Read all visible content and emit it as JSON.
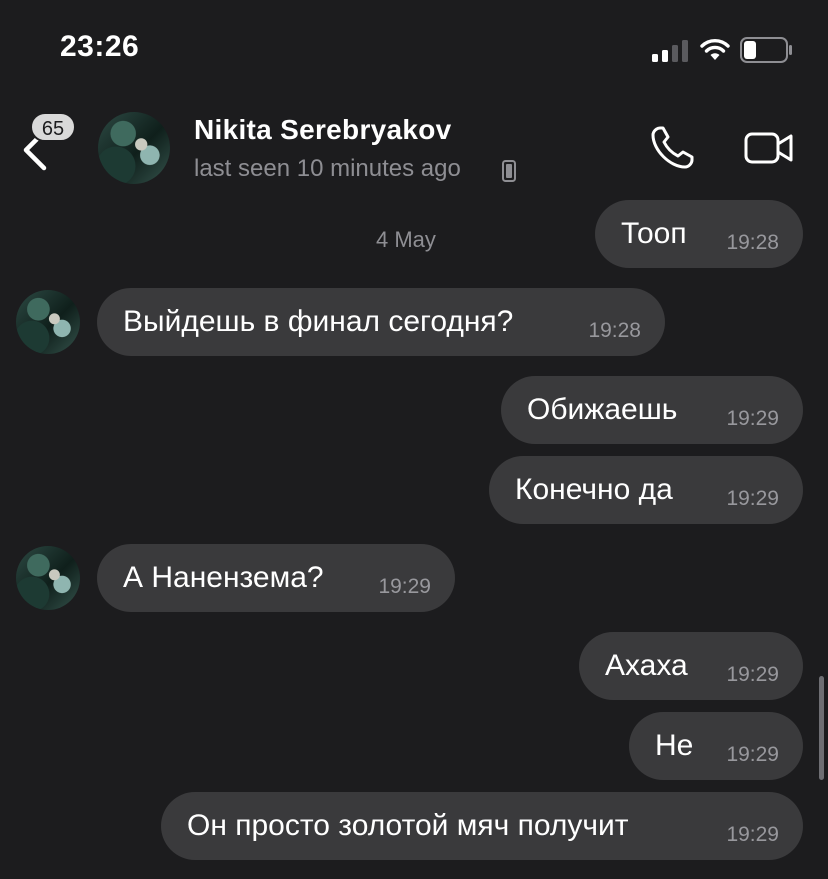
{
  "status_bar": {
    "time": "23:26"
  },
  "header": {
    "unread_count": "65",
    "contact_name": "Nikita Serebryakov",
    "last_seen": "last seen 10 minutes ago"
  },
  "chat": {
    "date_label": "4 May",
    "messages": [
      {
        "text": "Тооп",
        "time": "19:28",
        "direction": "outgoing"
      },
      {
        "text": "Выйдешь в финал сегодня?",
        "time": "19:28",
        "direction": "incoming"
      },
      {
        "text": "Обижаешь",
        "time": "19:29",
        "direction": "outgoing"
      },
      {
        "text": "Конечно да",
        "time": "19:29",
        "direction": "outgoing"
      },
      {
        "text": "А Нанензема?",
        "time": "19:29",
        "direction": "incoming"
      },
      {
        "text": "Ахаха",
        "time": "19:29",
        "direction": "outgoing"
      },
      {
        "text": "Не",
        "time": "19:29",
        "direction": "outgoing"
      },
      {
        "text": "Он просто золотой мяч получит",
        "time": "19:29",
        "direction": "outgoing"
      }
    ]
  },
  "colors": {
    "background": "#1c1c1e",
    "bubble": "#3a3a3c",
    "secondary_text": "#8e8e93"
  },
  "icons": [
    "signal-icon",
    "wifi-icon",
    "battery-icon",
    "back-chevron-icon",
    "phone-icon",
    "video-camera-icon",
    "device-icon"
  ]
}
